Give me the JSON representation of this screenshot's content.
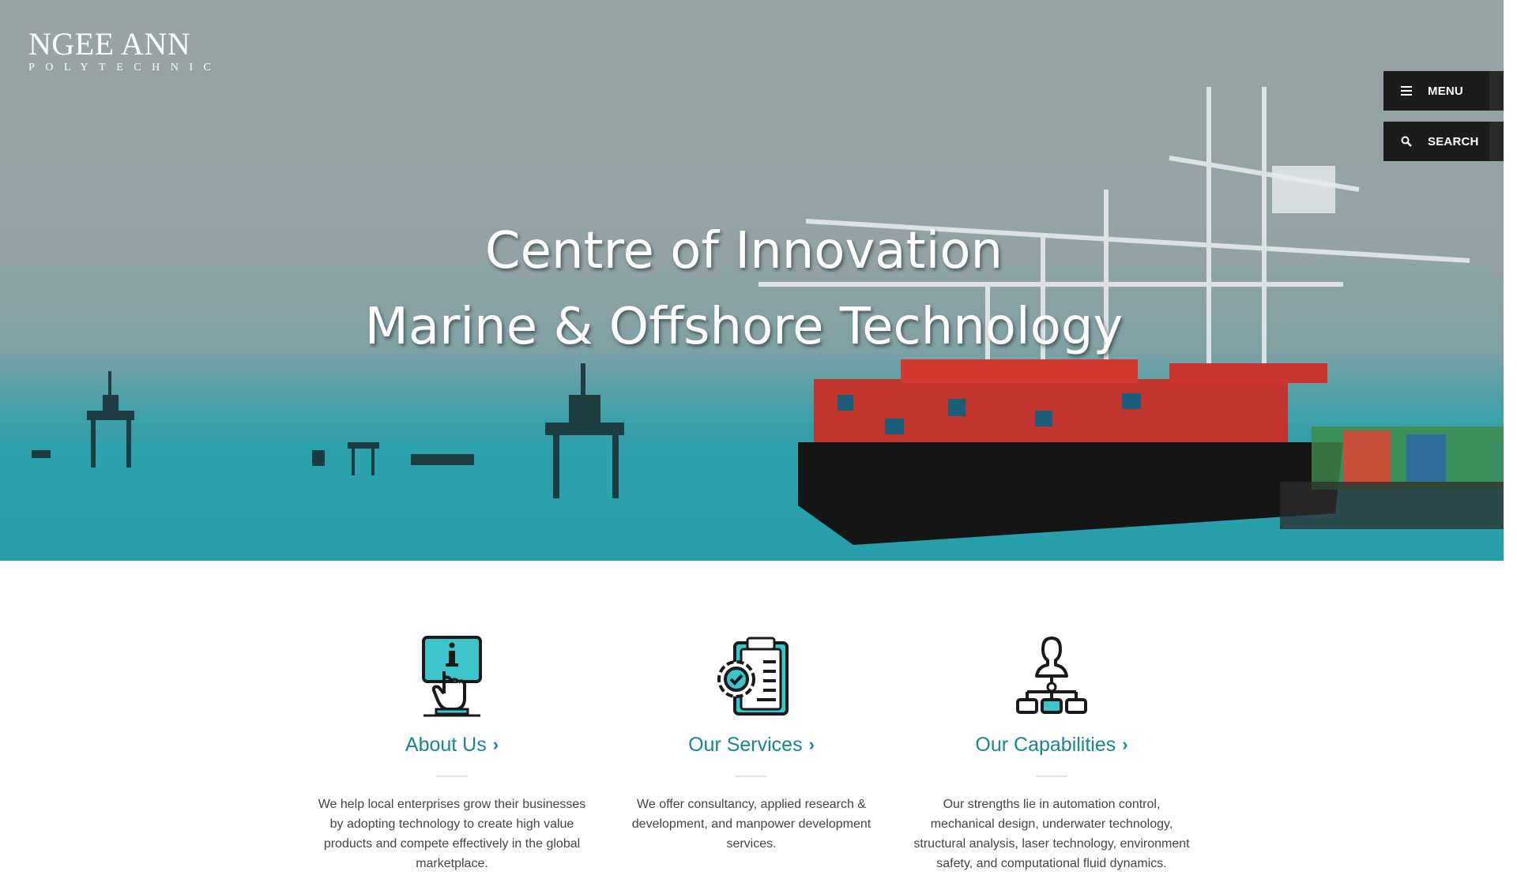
{
  "logo": {
    "line1": "NGEE ANN",
    "line2": "POLYTECHNIC"
  },
  "nav": {
    "menu_label": "MENU",
    "search_label": "SEARCH",
    "menu_icon": "hamburger-icon",
    "search_icon": "search-icon"
  },
  "hero": {
    "title_line1": "Centre of Innovation",
    "title_line2": "Marine & Offshore Technology"
  },
  "features": [
    {
      "title": "About Us",
      "icon": "info-touch-icon",
      "description": "We help local enterprises grow their businesses by adopting technology to create high value products and compete effectively in the global marketplace."
    },
    {
      "title": "Our Services",
      "icon": "clipboard-gear-icon",
      "description": "We offer consultancy, applied research & development, and manpower development services."
    },
    {
      "title": "Our Capabilities",
      "icon": "org-chart-icon",
      "description": "Our strengths lie in automation control, mechanical design, underwater technology, structural analysis, laser technology, environment safety, and computational fluid dynamics."
    }
  ],
  "colors": {
    "accent": "#17868f",
    "icon_fill": "#3cc6cc",
    "dark_button": "#1c1c1c"
  }
}
